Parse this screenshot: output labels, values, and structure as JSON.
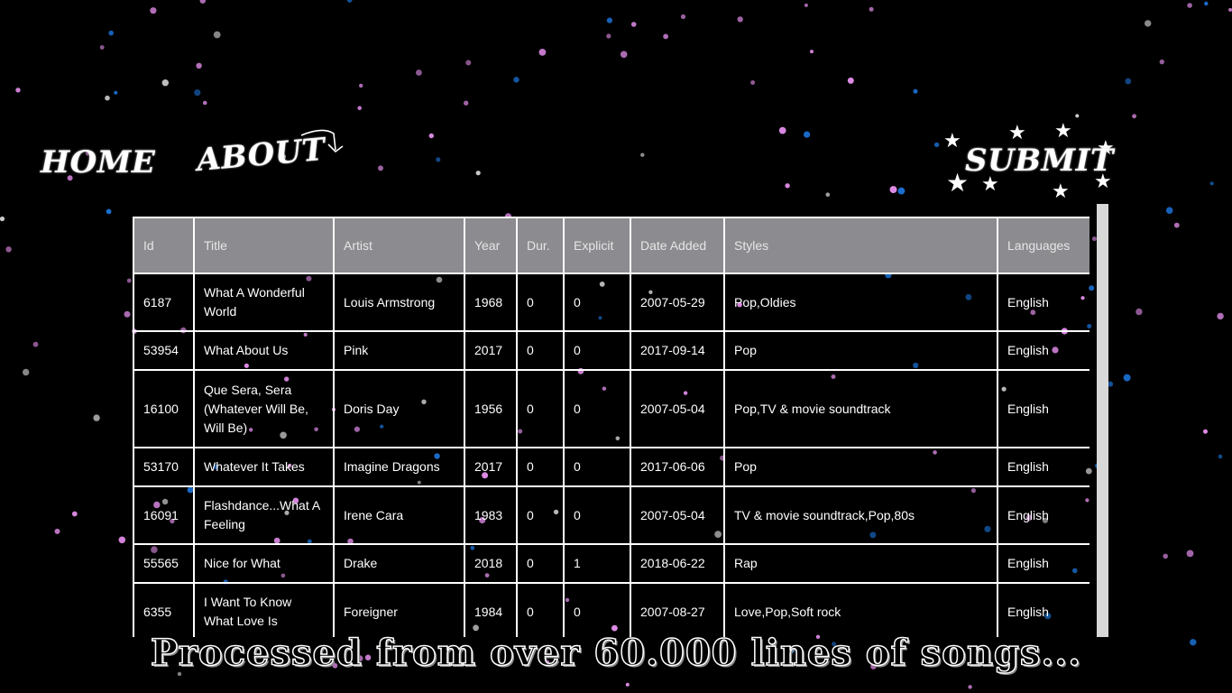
{
  "nav": {
    "home_label": "HOME",
    "about_label": "ABOUT",
    "submit_label": "SUBMIT"
  },
  "table": {
    "headers": [
      "Id",
      "Title",
      "Artist",
      "Year",
      "Dur.",
      "Explicit",
      "Date Added",
      "Styles",
      "Languages"
    ],
    "rows": [
      [
        "6187",
        "What A Wonderful World",
        "Louis Armstrong",
        "1968",
        "0",
        "0",
        "2007-05-29",
        "Pop,Oldies",
        "English"
      ],
      [
        "53954",
        "What About Us",
        "Pink",
        "2017",
        "0",
        "0",
        "2017-09-14",
        "Pop",
        "English"
      ],
      [
        "16100",
        "Que Sera, Sera (Whatever Will Be, Will Be)",
        "Doris Day",
        "1956",
        "0",
        "0",
        "2007-05-04",
        "Pop,TV & movie soundtrack",
        "English"
      ],
      [
        "53170",
        "Whatever It Takes",
        "Imagine Dragons",
        "2017",
        "0",
        "0",
        "2017-06-06",
        "Pop",
        "English"
      ],
      [
        "16091",
        "Flashdance...What A Feeling",
        "Irene Cara",
        "1983",
        "0",
        "0",
        "2007-05-04",
        "TV & movie soundtrack,Pop,80s",
        "English"
      ],
      [
        "55565",
        "Nice for What",
        "Drake",
        "2018",
        "0",
        "1",
        "2018-06-22",
        "Rap",
        "English"
      ],
      [
        "6355",
        "I Want To Know What Love Is",
        "Foreigner",
        "1984",
        "0",
        "0",
        "2007-08-27",
        "Love,Pop,Soft rock",
        "English"
      ]
    ]
  },
  "footer": {
    "text": "Processed from over 60.000 lines of songs..."
  },
  "colors": {
    "background": "#000000",
    "header_bg": "#8c8c90",
    "border": "#ffffff",
    "star_pink": "#e08ce8",
    "star_blue": "#1a6fd0",
    "scrollbar": "#d8d8d8"
  },
  "icons": {
    "about_arrow": "curved-arrow-icon",
    "submit_stars": "star-icon"
  }
}
